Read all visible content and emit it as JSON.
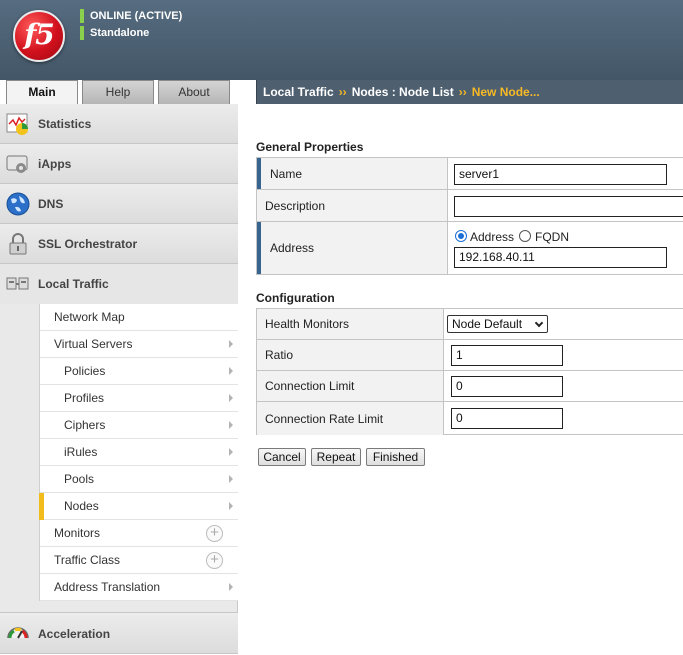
{
  "header": {
    "logo_text": "f5",
    "status": "ONLINE (ACTIVE)",
    "mode": "Standalone",
    "status_color": "#8bd04c"
  },
  "tabs": [
    {
      "label": "Main",
      "active": true
    },
    {
      "label": "Help",
      "active": false
    },
    {
      "label": "About",
      "active": false
    }
  ],
  "breadcrumb": {
    "part1": "Local Traffic",
    "part2": "Nodes : Node List",
    "current": "New Node...",
    "separator": "››"
  },
  "sidebar": {
    "groups": [
      {
        "label": "Statistics",
        "icon": "statistics-icon"
      },
      {
        "label": "iApps",
        "icon": "iapps-icon"
      },
      {
        "label": "DNS",
        "icon": "globe-icon"
      },
      {
        "label": "SSL Orchestrator",
        "icon": "lock-icon"
      },
      {
        "label": "Local Traffic",
        "icon": "local-traffic-icon"
      },
      {
        "label": "Acceleration",
        "icon": "gauge-icon"
      }
    ],
    "local_traffic_items": [
      {
        "label": "Network Map"
      },
      {
        "label": "Virtual Servers"
      },
      {
        "label": "Policies"
      },
      {
        "label": "Profiles"
      },
      {
        "label": "Ciphers"
      },
      {
        "label": "iRules"
      },
      {
        "label": "Pools"
      },
      {
        "label": "Nodes",
        "selected": true
      },
      {
        "label": "Monitors"
      },
      {
        "label": "Traffic Class"
      },
      {
        "label": "Address Translation"
      }
    ]
  },
  "general": {
    "title": "General Properties",
    "name_label": "Name",
    "name_value": "server1",
    "description_label": "Description",
    "description_value": "",
    "address_label": "Address",
    "address_option": "Address",
    "fqdn_option": "FQDN",
    "address_selected": "Address",
    "address_value": "192.168.40.11"
  },
  "configuration": {
    "title": "Configuration",
    "health_label": "Health Monitors",
    "health_value": "Node Default",
    "ratio_label": "Ratio",
    "ratio_value": "1",
    "conn_limit_label": "Connection Limit",
    "conn_limit_value": "0",
    "conn_rate_label": "Connection Rate Limit",
    "conn_rate_value": "0"
  },
  "buttons": {
    "cancel": "Cancel",
    "repeat": "Repeat",
    "finished": "Finished"
  }
}
